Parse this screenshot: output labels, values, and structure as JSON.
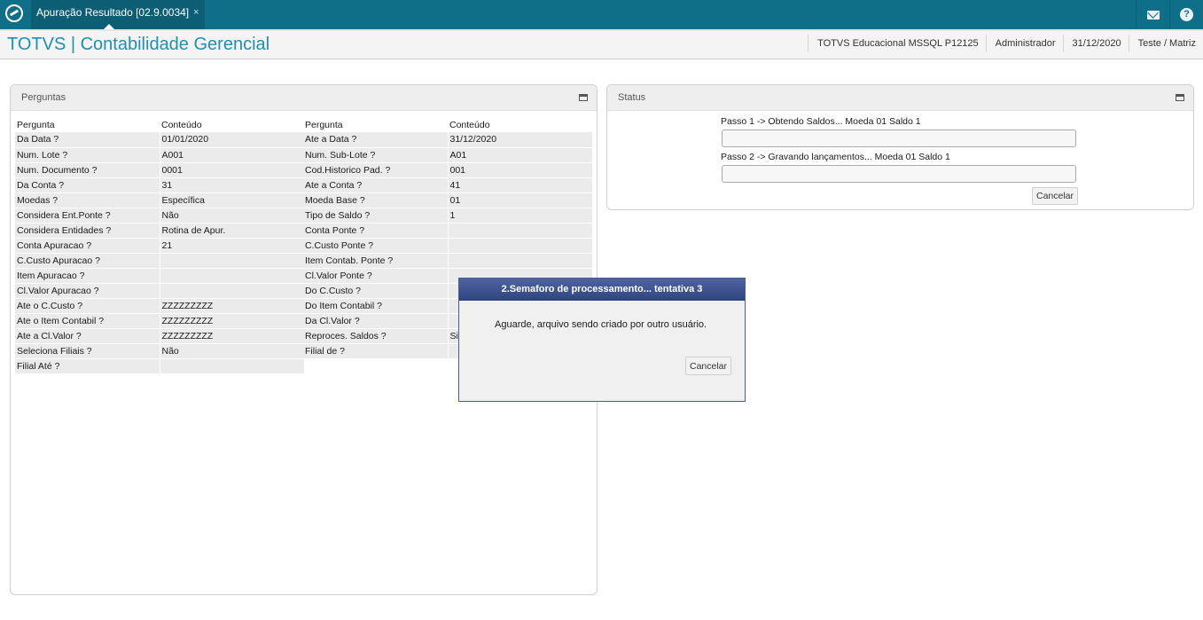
{
  "tab": {
    "title": "Apuração Resultado [02.9.0034]",
    "close": "×"
  },
  "top_icons": {
    "mail": "mail-icon",
    "help": "?"
  },
  "header": {
    "app_title": "TOTVS | Contabilidade Gerencial",
    "environment": "TOTVS Educacional MSSQL P12125",
    "user": "Administrador",
    "date": "31/12/2020",
    "company": "Teste / Matriz"
  },
  "questions_panel": {
    "title": "Perguntas",
    "col_question": "Pergunta",
    "col_content": "Conteúdo",
    "left_rows": [
      {
        "q": "Da Data ?",
        "v": "01/01/2020"
      },
      {
        "q": "Num. Lote ?",
        "v": "A001"
      },
      {
        "q": "Num. Documento ?",
        "v": "0001"
      },
      {
        "q": "Da Conta ?",
        "v": "31"
      },
      {
        "q": "Moedas ?",
        "v": "Específica"
      },
      {
        "q": "Considera Ent.Ponte ?",
        "v": "Não"
      },
      {
        "q": "Considera Entidades ?",
        "v": "Rotina de Apur."
      },
      {
        "q": "Conta Apuracao ?",
        "v": "21"
      },
      {
        "q": "C.Custo Apuracao ?",
        "v": ""
      },
      {
        "q": "Item Apuracao ?",
        "v": ""
      },
      {
        "q": "Cl.Valor Apuracao ?",
        "v": ""
      },
      {
        "q": "Ate o C.Custo ?",
        "v": "ZZZZZZZZZ"
      },
      {
        "q": "Ate o Item Contabil ?",
        "v": "ZZZZZZZZZ"
      },
      {
        "q": "Ate a Cl.Valor ?",
        "v": "ZZZZZZZZZ"
      },
      {
        "q": "Seleciona Filiais ?",
        "v": "Não"
      },
      {
        "q": "Filial Até ?",
        "v": ""
      }
    ],
    "right_rows": [
      {
        "q": "Ate a Data ?",
        "v": "31/12/2020"
      },
      {
        "q": "Num. Sub-Lote ?",
        "v": "A01"
      },
      {
        "q": "Cod.Historico Pad. ?",
        "v": "001"
      },
      {
        "q": "Ate a Conta ?",
        "v": "41"
      },
      {
        "q": "Moeda Base ?",
        "v": "01"
      },
      {
        "q": "Tipo de Saldo ?",
        "v": "1"
      },
      {
        "q": "Conta Ponte ?",
        "v": ""
      },
      {
        "q": "C.Custo Ponte ?",
        "v": ""
      },
      {
        "q": "Item Contab. Ponte ?",
        "v": ""
      },
      {
        "q": "Cl.Valor Ponte ?",
        "v": ""
      },
      {
        "q": "Do C.Custo ?",
        "v": ""
      },
      {
        "q": "Do Item Contabil ?",
        "v": ""
      },
      {
        "q": "Da Cl.Valor ?",
        "v": ""
      },
      {
        "q": "Reproces. Saldos ?",
        "v": "Si"
      },
      {
        "q": "Filial de ?",
        "v": ""
      }
    ]
  },
  "status_panel": {
    "title": "Status",
    "step1": "Passo 1 -> Obtendo Saldos... Moeda 01 Saldo 1",
    "step2": "Passo 2 -> Gravando lançamentos... Moeda 01 Saldo 1",
    "cancel": "Cancelar"
  },
  "dialog": {
    "title": "2.Semaforo de processamento... tentativa 3",
    "message": "Aguarde, arquivo sendo criado por outro usuário.",
    "cancel": "Cancelar"
  }
}
